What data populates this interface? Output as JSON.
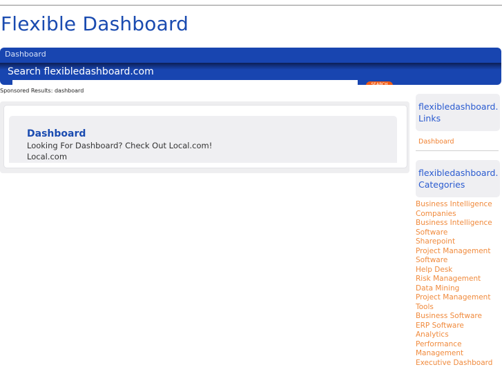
{
  "header": {
    "title": "Flexible Dashboard",
    "nav": [
      "Dashboard"
    ],
    "search_label": "Search flexibledashboard.com",
    "search_value": "",
    "search_button": "SEARCH"
  },
  "main": {
    "sponsored_label": "Sponsored Results: dashboard",
    "ads": [
      {
        "title": "Dashboard",
        "description": "Looking For Dashboard? Check Out Local.com!",
        "url": "Local.com"
      }
    ]
  },
  "sidebar": {
    "links_box": {
      "title_line1": "flexibledashboard.",
      "title_line2": "Links",
      "items": [
        "Dashboard"
      ]
    },
    "categories_box": {
      "title_line1": "flexibledashboard.",
      "title_line2": "Categories",
      "items": [
        "Business Intelligence Companies",
        "Business Intelligence Software",
        "Sharepoint",
        "Project Management Software",
        "Help Desk",
        "Risk Management",
        "Data Mining",
        "Project Management Tools",
        "Business Software",
        "ERP Software",
        "Analytics",
        "Performance Management",
        "Executive Dashboard"
      ]
    }
  },
  "colors": {
    "brand_blue": "#1845b0",
    "title_blue": "#1a4bb0",
    "link_orange": "#f08a3c",
    "button_orange": "#f05a14"
  }
}
